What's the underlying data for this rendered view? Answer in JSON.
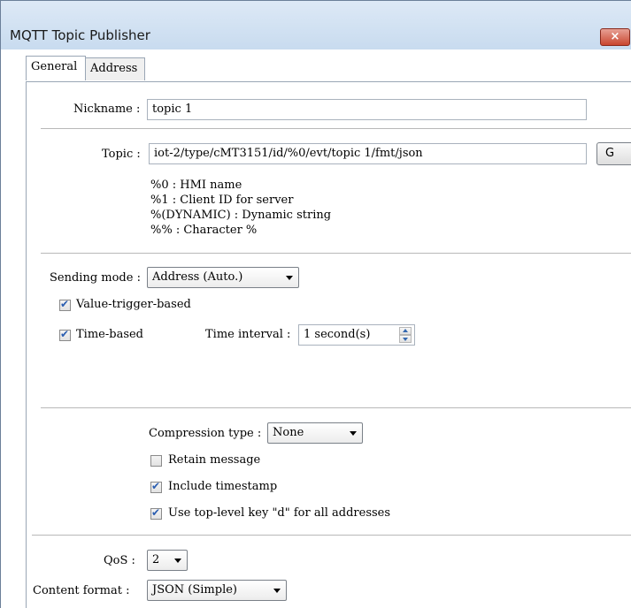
{
  "window": {
    "title": "MQTT Topic Publisher",
    "close_glyph": "×"
  },
  "tabs": [
    {
      "label": "General",
      "active": true
    },
    {
      "label": "Address",
      "active": false
    }
  ],
  "general": {
    "nickname_label": "Nickname :",
    "nickname_value": "topic 1",
    "topic_label": "Topic :",
    "topic_value": "iot-2/type/cMT3151/id/%0/evt/topic 1/fmt/json",
    "topic_button_label": "G",
    "topic_help": [
      "%0 : HMI name",
      "%1 : Client ID for server",
      "%(DYNAMIC) : Dynamic string",
      "%% : Character %"
    ],
    "sending_mode_label": "Sending mode :",
    "sending_mode_value": "Address (Auto.)",
    "value_trigger_label": "Value-trigger-based",
    "value_trigger_checked": true,
    "time_based_label": "Time-based",
    "time_based_checked": true,
    "time_interval_label": "Time interval :",
    "time_interval_value": "1 second(s)",
    "compression_label": "Compression type :",
    "compression_value": "None",
    "retain_label": "Retain message",
    "retain_checked": false,
    "timestamp_label": "Include timestamp",
    "timestamp_checked": true,
    "toplevel_label": "Use top-level key \"d\" for all addresses",
    "toplevel_checked": true,
    "qos_label": "QoS :",
    "qos_value": "2",
    "content_format_label": "Content format :",
    "content_format_value": "JSON (Simple)"
  },
  "icons": {
    "close": "close-icon",
    "dropdown": "chevron-down-icon",
    "spinner_up": "spin-up-icon",
    "spinner_down": "spin-down-icon",
    "check": "checkmark-icon"
  }
}
